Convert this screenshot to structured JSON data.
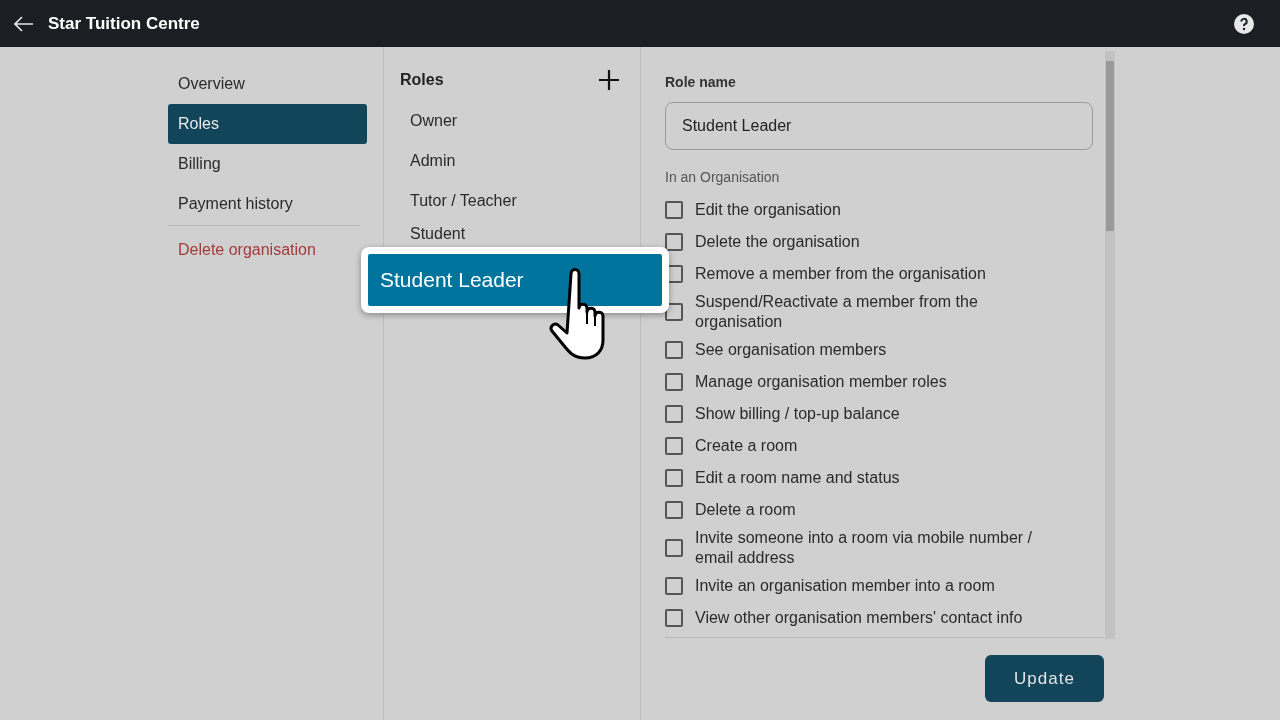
{
  "header": {
    "title": "Star Tuition Centre"
  },
  "nav": [
    {
      "label": "Overview",
      "selected": false,
      "kind": "normal"
    },
    {
      "label": "Roles",
      "selected": true,
      "kind": "normal"
    },
    {
      "label": "Billing",
      "selected": false,
      "kind": "normal"
    },
    {
      "label": "Payment history",
      "selected": false,
      "kind": "normal"
    },
    {
      "label": "Delete organisation",
      "selected": false,
      "kind": "danger"
    }
  ],
  "roles": {
    "title": "Roles",
    "items": [
      "Owner",
      "Admin",
      "Tutor / Teacher",
      "Student"
    ],
    "dragged_item": "Student Leader"
  },
  "form": {
    "label": "Role name",
    "value": "Student Leader",
    "section": "In an Organisation",
    "permissions": [
      {
        "label": "Edit the organisation",
        "checked": false
      },
      {
        "label": "Delete the organisation",
        "checked": false
      },
      {
        "label": "Remove a member from the organisation",
        "checked": false
      },
      {
        "label": "Suspend/Reactivate a member from the organisation",
        "checked": false
      },
      {
        "label": "See organisation members",
        "checked": false
      },
      {
        "label": "Manage organisation member roles",
        "checked": false
      },
      {
        "label": "Show billing / top-up balance",
        "checked": false
      },
      {
        "label": "Create a room",
        "checked": false
      },
      {
        "label": "Edit a room name and status",
        "checked": false
      },
      {
        "label": "Delete a room",
        "checked": false
      },
      {
        "label": "Invite someone into a room via mobile number / email address",
        "checked": false
      },
      {
        "label": "Invite an organisation member into a room",
        "checked": false
      },
      {
        "label": "View other organisation members' contact info",
        "checked": false
      }
    ],
    "button": "Update"
  }
}
